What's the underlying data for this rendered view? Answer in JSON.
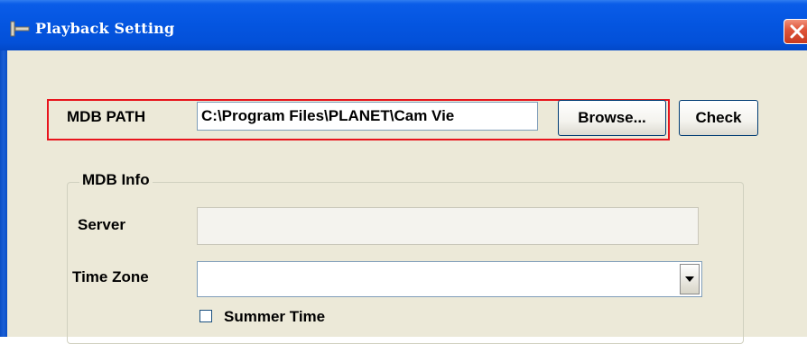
{
  "window": {
    "title": "Playback Setting",
    "icon": "playback-app-icon"
  },
  "mdb_path": {
    "label": "MDB PATH",
    "value": "C:\\Program Files\\PLANET\\Cam Vie",
    "browse_label": "Browse...",
    "check_label": "Check"
  },
  "mdb_info": {
    "group_title": "MDB Info",
    "server_label": "Server",
    "server_value": "",
    "timezone_label": "Time Zone",
    "timezone_value": "",
    "summer_time_label": "Summer Time",
    "summer_time_checked": false
  },
  "colors": {
    "titlebar": "#0455e0",
    "highlight": "#e8141c",
    "dialog_bg": "#ece9d8"
  }
}
